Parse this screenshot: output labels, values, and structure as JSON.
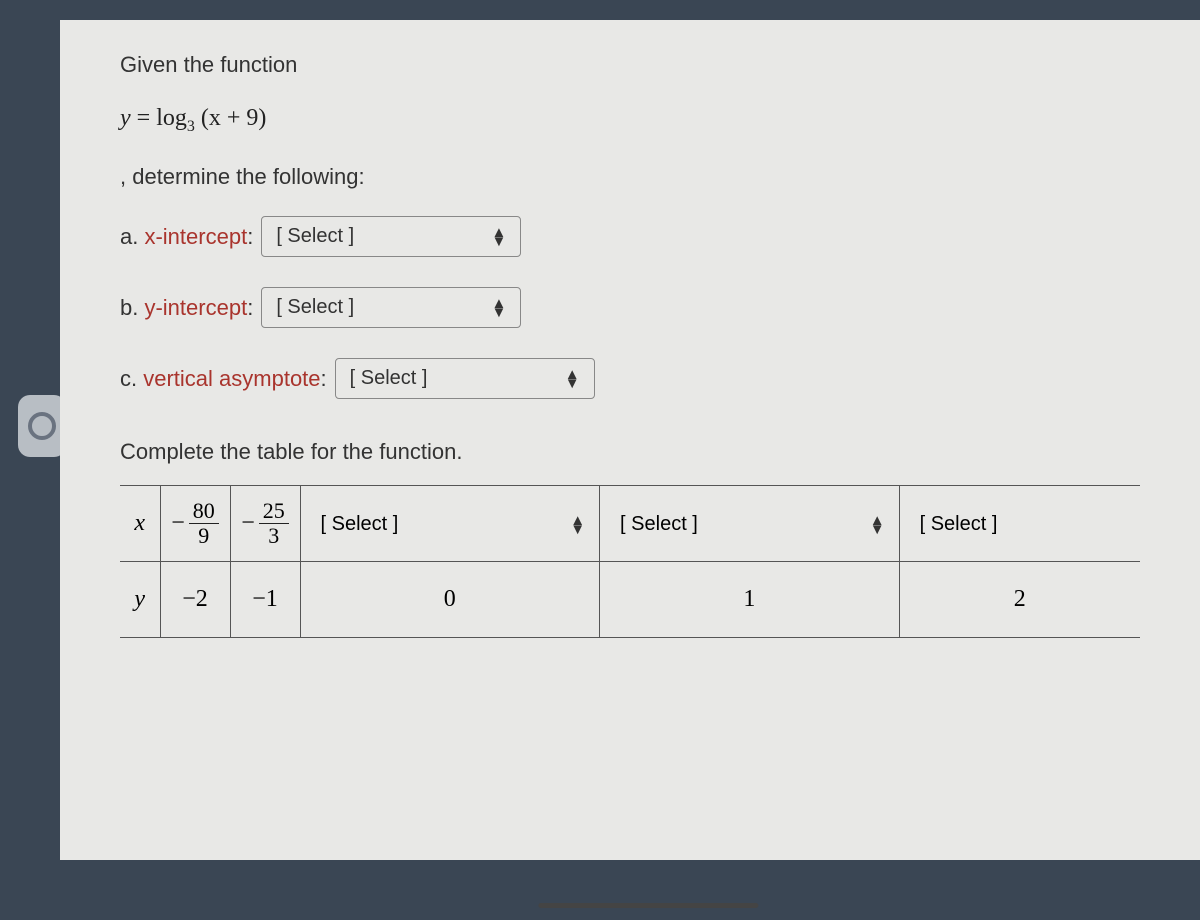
{
  "prompt": {
    "line1": "Given the function",
    "equation_lhs": "y",
    "equation_eq": " = ",
    "equation_log": "log",
    "equation_base": "3",
    "equation_arg": " (x + 9)",
    "line2": ", determine the following:"
  },
  "questions": {
    "a_prefix": "a. ",
    "a_term": "x-intercept",
    "a_suffix": ":",
    "b_prefix": "b. ",
    "b_term": "y-intercept",
    "b_suffix": ":",
    "c_prefix": "c. ",
    "c_term": "vertical asymptote",
    "c_suffix": ":"
  },
  "select_placeholder": "[ Select ]",
  "table_prompt": "Complete the table for the function.",
  "table": {
    "row_x_label": "x",
    "row_y_label": "y",
    "x_col1_num": "80",
    "x_col1_den": "9",
    "x_col2_num": "25",
    "x_col2_den": "3",
    "y_col1": "−2",
    "y_col2": "−1",
    "y_col3": "0",
    "y_col4": "1",
    "y_col5": "2"
  }
}
